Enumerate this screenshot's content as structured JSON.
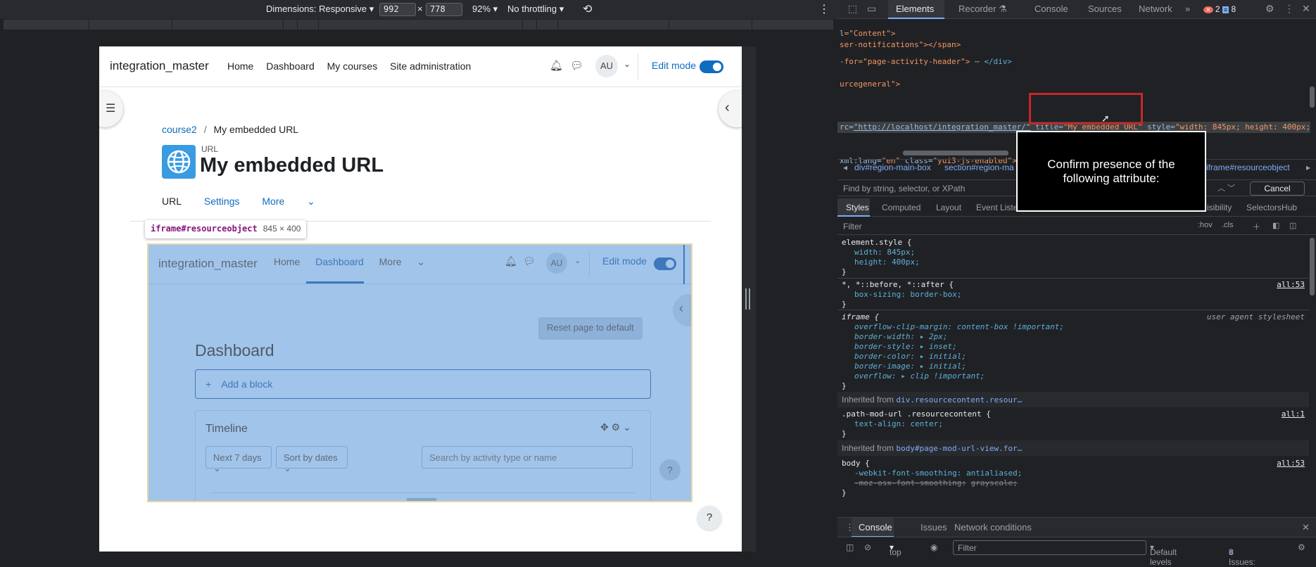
{
  "device_toolbar": {
    "dimensions_label": "Dimensions: Responsive",
    "width": "992",
    "height": "778",
    "times": "×",
    "zoom": "92%",
    "throttling": "No throttling"
  },
  "moodle": {
    "brand": "integration_master",
    "nav": [
      "Home",
      "Dashboard",
      "My courses",
      "Site administration"
    ],
    "avatar": "AU",
    "edit_mode": "Edit mode",
    "breadcrumb": {
      "course": "course2",
      "sep": "/",
      "current": "My embedded URL"
    },
    "activity_type": "URL",
    "page_title": "My embedded URL",
    "tabs": [
      "URL",
      "Settings",
      "More"
    ],
    "help": "?"
  },
  "tooltip": {
    "element": "iframe#resourceobject",
    "size": "845 × 400"
  },
  "iframe": {
    "brand": "integration_master",
    "nav": [
      "Home",
      "Dashboard",
      "More"
    ],
    "avatar": "AU",
    "edit_mode": "Edit mode",
    "reset_button": "Reset page to default",
    "heading": "Dashboard",
    "add_block": "Add a block",
    "timeline_title": "Timeline",
    "filter_days": "Next 7 days",
    "sort": "Sort by dates",
    "search_placeholder": "Search by activity type or name",
    "help": "?"
  },
  "devtools": {
    "tabs": [
      "Elements",
      "Recorder",
      "Console",
      "Sources",
      "Network"
    ],
    "errors": "2",
    "messages": "8",
    "elements_lines": {
      "l1": "=\"Content\">",
      "l2": "ser-notifications\"></span>",
      "l3": "-for=\"page-activity-header\">",
      "l3b": "</div>",
      "l4": "urcegeneral\">",
      "sel_a": "rc=",
      "sel_url": "\"http://localhost/integration_master/\"",
      "sel_title_attr": "title=",
      "sel_title_val": "\"My embedded URL\"",
      "sel_style": "style=",
      "sel_style_val": "\"width: 845px; height: 400px;",
      "l6_attr": "xml:lang=",
      "l6_val": "\"en\"",
      "l6_class": "class=",
      "l6_classval": "\"yui3-js-enabled\">"
    },
    "breadcrumbs": [
      "div#region-main-box",
      "section#region-ma",
      "iframe#resourceobject"
    ],
    "find_placeholder": "Find by string, selector, or XPath",
    "cancel": "Cancel",
    "subtabs": [
      "Styles",
      "Computed",
      "Layout",
      "Event Liste",
      "isibility",
      "SelectorsHub"
    ],
    "filter_placeholder": "Filter",
    "hov": ":hov",
    "cls": ".cls",
    "styles": {
      "element_style": "element.style {",
      "width": "width: 845px;",
      "height": "height: 400px;",
      "universal": "*, *::before, *::after {",
      "boxsizing": "box-sizing: border-box;",
      "src_all53": "all:53",
      "iframe_sel": "iframe {",
      "ua": "user agent stylesheet",
      "ocm": "overflow-clip-margin: content-box !important;",
      "bw": "border-width: ▸ 2px;",
      "bs": "border-style: ▸ inset;",
      "bc": "border-color: ▸ initial;",
      "bi": "border-image: ▸ initial;",
      "ov": "overflow: ▸ clip !important;",
      "inh1_label": "Inherited from",
      "inh1": "div.resourcecontent.resour…",
      "pm_sel": ".path-mod-url .resourcecontent {",
      "src_all1": "all:1",
      "ta": "text-align: center;",
      "inh2": "body#page-mod-url-view.for…",
      "body_sel": "body {",
      "wfs": "-webkit-font-smoothing: antialiased;",
      "mofs_prop": "-moz-osx-font-smoothing:",
      "mofs_val": "grayscale;",
      "close": "}"
    },
    "console_tabs": [
      "Console",
      "Issues",
      "Network conditions"
    ],
    "console_context": "top",
    "console_filter": "Filter",
    "levels": "Default levels",
    "issues": "8 Issues:",
    "issues_count": "8"
  },
  "overlay": {
    "text": "Confirm presence of the following attribute:"
  }
}
